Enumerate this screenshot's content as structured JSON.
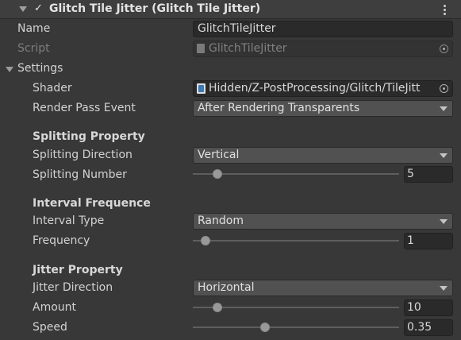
{
  "header": {
    "title": "Glitch Tile Jitter (Glitch Tile Jitter)",
    "checkbox": "✓"
  },
  "fields": {
    "name_label": "Name",
    "name_value": "GlitchTileJitter",
    "script_label": "Script",
    "script_value": "GlitchTileJitter"
  },
  "settings": {
    "label": "Settings",
    "shader_label": "Shader",
    "shader_value": "Hidden/Z-PostProcessing/Glitch/TileJitt",
    "render_pass_label": "Render Pass Event",
    "render_pass_value": "After Rendering Transparents"
  },
  "splitting": {
    "heading": "Splitting Property",
    "direction_label": "Splitting Direction",
    "direction_value": "Vertical",
    "number_label": "Splitting Number",
    "number_value": "5",
    "number_fraction": 0.12
  },
  "interval": {
    "heading": "Interval Frequence",
    "type_label": "Interval Type",
    "type_value": "Random",
    "frequency_label": "Frequency",
    "frequency_value": "1",
    "frequency_fraction": 0.06
  },
  "jitter": {
    "heading": "Jitter Property",
    "direction_label": "Jitter Direction",
    "direction_value": "Horizontal",
    "amount_label": "Amount",
    "amount_value": "10",
    "amount_fraction": 0.12,
    "speed_label": "Speed",
    "speed_value": "0.35",
    "speed_fraction": 0.35
  },
  "icons": {
    "script_icon": "script-file-icon",
    "shader_icon": "shader-file-icon",
    "target_icon": "object-picker-icon",
    "menu_icon": "kebab-menu-icon"
  }
}
